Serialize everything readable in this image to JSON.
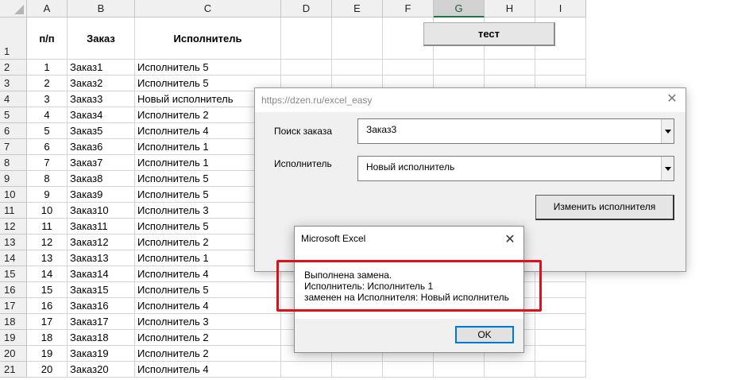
{
  "columns": [
    "A",
    "B",
    "C",
    "D",
    "E",
    "F",
    "G",
    "H",
    "I"
  ],
  "selected_column": "G",
  "header_row": {
    "num": "1",
    "a": "п/п",
    "b": "Заказ",
    "c": "Исполнитель"
  },
  "rows": [
    {
      "num": "2",
      "a": "1",
      "b": "Заказ1",
      "c": "Исполнитель 5"
    },
    {
      "num": "3",
      "a": "2",
      "b": "Заказ2",
      "c": "Исполнитель 5"
    },
    {
      "num": "4",
      "a": "3",
      "b": "Заказ3",
      "c": "Новый исполнитель"
    },
    {
      "num": "5",
      "a": "4",
      "b": "Заказ4",
      "c": "Исполнитель 2"
    },
    {
      "num": "6",
      "a": "5",
      "b": "Заказ5",
      "c": "Исполнитель 4"
    },
    {
      "num": "7",
      "a": "6",
      "b": "Заказ6",
      "c": "Исполнитель 1"
    },
    {
      "num": "8",
      "a": "7",
      "b": "Заказ7",
      "c": "Исполнитель 1"
    },
    {
      "num": "9",
      "a": "8",
      "b": "Заказ8",
      "c": "Исполнитель 5"
    },
    {
      "num": "10",
      "a": "9",
      "b": "Заказ9",
      "c": "Исполнитель 5"
    },
    {
      "num": "11",
      "a": "10",
      "b": "Заказ10",
      "c": "Исполнитель 3"
    },
    {
      "num": "12",
      "a": "11",
      "b": "Заказ11",
      "c": "Исполнитель 5"
    },
    {
      "num": "13",
      "a": "12",
      "b": "Заказ12",
      "c": "Исполнитель 2"
    },
    {
      "num": "14",
      "a": "13",
      "b": "Заказ13",
      "c": "Исполнитель 1"
    },
    {
      "num": "15",
      "a": "14",
      "b": "Заказ14",
      "c": "Исполнитель 4"
    },
    {
      "num": "16",
      "a": "15",
      "b": "Заказ15",
      "c": "Исполнитель 5"
    },
    {
      "num": "17",
      "a": "16",
      "b": "Заказ16",
      "c": "Исполнитель 4"
    },
    {
      "num": "18",
      "a": "17",
      "b": "Заказ17",
      "c": "Исполнитель 3"
    },
    {
      "num": "19",
      "a": "18",
      "b": "Заказ18",
      "c": "Исполнитель 2"
    },
    {
      "num": "20",
      "a": "19",
      "b": "Заказ19",
      "c": "Исполнитель 2"
    },
    {
      "num": "21",
      "a": "20",
      "b": "Заказ20",
      "c": "Исполнитель 4"
    }
  ],
  "sheet_button": {
    "label": "тест"
  },
  "form": {
    "title": "https://dzen.ru/excel_easy",
    "close_glyph": "✕",
    "order_label": "Поиск заказа",
    "order_value": "Заказ3",
    "executor_label": "Исполнитель",
    "executor_value": "Новый исполнитель",
    "change_button": "Изменить исполнителя"
  },
  "msgbox": {
    "title": "Microsoft Excel",
    "close_glyph": "✕",
    "line1": "Выполнена замена.",
    "line2": "Исполнитель: Исполнитель 1",
    "line3": "заменен на Исполнителя: Новый исполнитель",
    "ok": "OK"
  },
  "colors": {
    "highlight": "#e0101b",
    "excel_green": "#217346",
    "focus_blue": "#0078d7"
  }
}
